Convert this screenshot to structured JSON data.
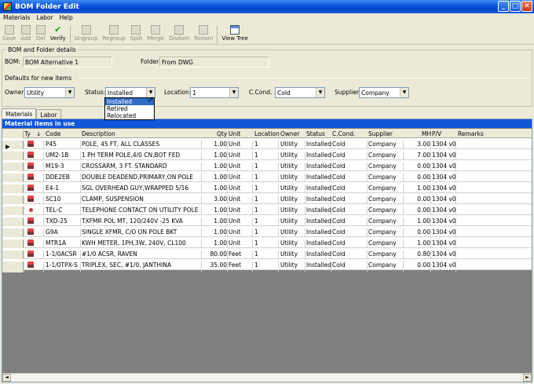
{
  "window": {
    "title": "BOM Folder Edit",
    "min": "_",
    "max": "□",
    "close": "✕"
  },
  "menu": [
    "Materials",
    "Labor",
    "Help"
  ],
  "toolbar": [
    {
      "label": "Save",
      "icon": "save-icon",
      "enabled": false
    },
    {
      "label": "Add",
      "icon": "add-icon",
      "enabled": false
    },
    {
      "label": "Del",
      "icon": "delete-icon",
      "enabled": false
    },
    {
      "label": "Verify",
      "icon": "verify-icon",
      "enabled": true
    },
    {
      "label": "Ungroup",
      "icon": "ungroup-icon",
      "enabled": false
    },
    {
      "label": "Regroup",
      "icon": "regroup-icon",
      "enabled": false
    },
    {
      "label": "Split",
      "icon": "split-icon",
      "enabled": false
    },
    {
      "label": "Merge",
      "icon": "merge-icon",
      "enabled": false
    },
    {
      "label": "DisAsm",
      "icon": "disassemble-icon",
      "enabled": false
    },
    {
      "label": "ReAsm",
      "icon": "reassemble-icon",
      "enabled": false
    },
    {
      "label": "View Tree",
      "icon": "tree-icon",
      "enabled": true
    }
  ],
  "details": {
    "legend": "BOM and Folder details",
    "bom_label": "BOM:",
    "bom_value": "BOM Alternative 1",
    "folder_label": "Folder:",
    "folder_value": "From DWG",
    "defaults_label": "Defaults for new items",
    "owner_label": "Owner:",
    "owner_value": "Utility",
    "status_label": "Status:",
    "status_value": "Installed",
    "location_label": "Location:",
    "location_value": "1",
    "ccond_label": "C.Cond.",
    "ccond_value": "Cold",
    "supplier_label": "Supplier:",
    "supplier_value": "Company"
  },
  "status_options": [
    "Installed",
    "Retired",
    "Relocated"
  ],
  "tabs": [
    "Materials",
    "Labor"
  ],
  "panel_title": "Material items in use",
  "columns": [
    "Ty",
    "↓",
    "Code",
    "Description",
    "Qty",
    "Unit",
    "Location",
    "Owner",
    "Status",
    "C.Cond.",
    "Supplier",
    "MH",
    "P/V",
    "Remarks"
  ],
  "rows": [
    {
      "code": "P45",
      "desc": "POLE, 45 FT, ALL CLASSES",
      "qty": "1.00",
      "unit": "Unit",
      "loc": "1",
      "owner": "Utility",
      "status": "Installed",
      "ccond": "Cold",
      "supplier": "Company",
      "mh": "3.00",
      "pv": "1304 v0",
      "icon": "assembly"
    },
    {
      "code": "UM2-1B",
      "desc": "1 PH TERM POLE,4/0 CN,BOT FED",
      "qty": "1.00",
      "unit": "Unit",
      "loc": "1",
      "owner": "Utility",
      "status": "Installed",
      "ccond": "Cold",
      "supplier": "Company",
      "mh": "7.00",
      "pv": "1304 v0",
      "icon": "assembly"
    },
    {
      "code": "M19-3",
      "desc": "CROSSARM, 3 FT. STANDARD",
      "qty": "1.00",
      "unit": "Unit",
      "loc": "1",
      "owner": "Utility",
      "status": "Installed",
      "ccond": "Cold",
      "supplier": "Company",
      "mh": "0.00",
      "pv": "1304 v0",
      "icon": "assembly"
    },
    {
      "code": "DDE2EB",
      "desc": "DOUBLE DEADEND,PRIMARY,ON POLE",
      "qty": "1.00",
      "unit": "Unit",
      "loc": "1",
      "owner": "Utility",
      "status": "Installed",
      "ccond": "Cold",
      "supplier": "Company",
      "mh": "0.00",
      "pv": "1304 v0",
      "icon": "assembly"
    },
    {
      "code": "E4-1",
      "desc": "SGL OVERHEAD GUY,WRAPPED 5/16",
      "qty": "1.00",
      "unit": "Unit",
      "loc": "1",
      "owner": "Utility",
      "status": "Installed",
      "ccond": "Cold",
      "supplier": "Company",
      "mh": "1.00",
      "pv": "1304 v0",
      "icon": "assembly"
    },
    {
      "code": "SC10",
      "desc": "CLAMP, SUSPENSION",
      "qty": "3.00",
      "unit": "Unit",
      "loc": "1",
      "owner": "Utility",
      "status": "Installed",
      "ccond": "Cold",
      "supplier": "Company",
      "mh": "0.00",
      "pv": "1304 v0",
      "icon": "assembly"
    },
    {
      "code": "TEL-C",
      "desc": "TELEPHONE CONTACT ON UTILITY POLE",
      "qty": "1.00",
      "unit": "Unit",
      "loc": "1",
      "owner": "Utility",
      "status": "Installed",
      "ccond": "Cold",
      "supplier": "Company",
      "mh": "0.00",
      "pv": "1304 v0",
      "icon": "part"
    },
    {
      "code": "TXD-25",
      "desc": "TXFMR POL MT, 120/240V -25 KVA",
      "qty": "1.00",
      "unit": "Unit",
      "loc": "1",
      "owner": "Utility",
      "status": "Installed",
      "ccond": "Cold",
      "supplier": "Company",
      "mh": "1.00",
      "pv": "1304 v0",
      "icon": "assembly"
    },
    {
      "code": "G9A",
      "desc": "SINGLE XFMR, C/O ON POLE BKT",
      "qty": "1.00",
      "unit": "Unit",
      "loc": "1",
      "owner": "Utility",
      "status": "Installed",
      "ccond": "Cold",
      "supplier": "Company",
      "mh": "0.00",
      "pv": "1304 v0",
      "icon": "assembly"
    },
    {
      "code": "MTR1A",
      "desc": "KWH METER, 1PH,3W, 240V, CL100",
      "qty": "1.00",
      "unit": "Unit",
      "loc": "1",
      "owner": "Utility",
      "status": "Installed",
      "ccond": "Cold",
      "supplier": "Company",
      "mh": "1.00",
      "pv": "1304 v0",
      "icon": "assembly"
    },
    {
      "code": "1-1/0ACSR",
      "desc": "#1/0 ACSR, RAVEN",
      "qty": "80.00",
      "unit": "Feet",
      "loc": "1",
      "owner": "Utility",
      "status": "Installed",
      "ccond": "Cold",
      "supplier": "Company",
      "mh": "0.80",
      "pv": "1304 v0",
      "icon": "assembly"
    },
    {
      "code": "1-1/0TPX-S",
      "desc": "TRIPLEX, SEC, #1/0, JANTHINA",
      "qty": "35.00",
      "unit": "Feet",
      "loc": "1",
      "owner": "Utility",
      "status": "Installed",
      "ccond": "Cold",
      "supplier": "Company",
      "mh": "0.00",
      "pv": "1304 v0",
      "icon": "assembly"
    }
  ],
  "scroll_left": "◄",
  "scroll_right": "►"
}
